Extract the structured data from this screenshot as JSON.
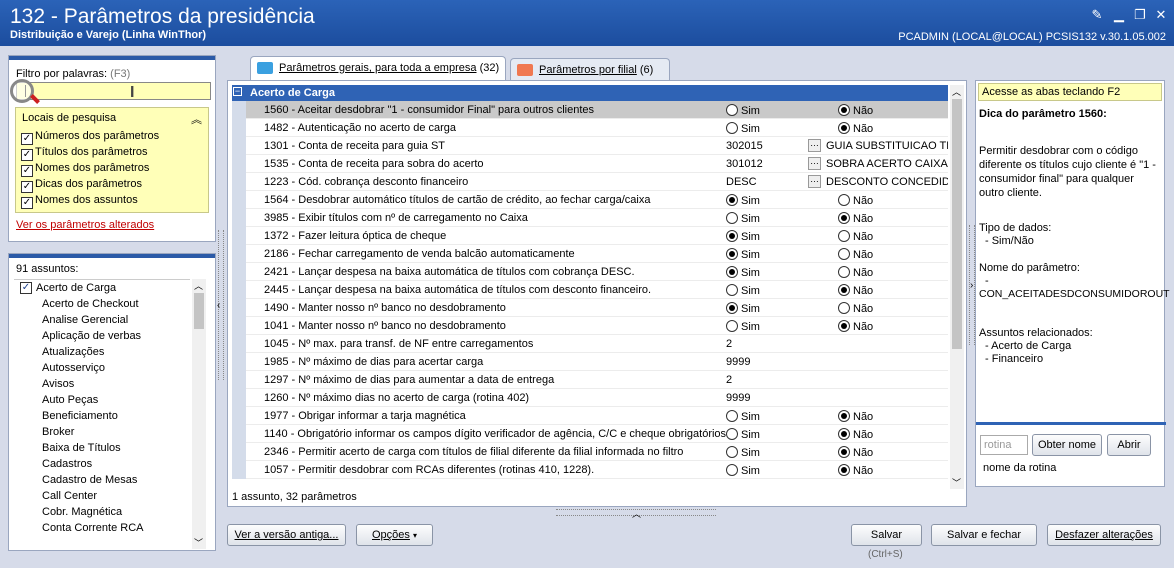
{
  "window": {
    "title": "132 - Parâmetros da presidência",
    "subtitle": "Distribuição e Varejo (Linha WinThor)",
    "user_info": "PCADMIN (LOCAL@LOCAL)   PCSIS132  v.30.1.05.002",
    "colors": {
      "titlebar": "#2b63b8",
      "section": "#2f63b5",
      "highlight": "#ffffb8",
      "link": "#c00000"
    }
  },
  "filter": {
    "label": "Filtro por palavras:",
    "hint": "(F3)",
    "value": "",
    "locais_title": "Locais de pesquisa",
    "locais": [
      "Números dos parâmetros",
      "Títulos dos parâmetros",
      "Nomes dos parâmetros",
      "Dicas dos parâmetros",
      "Nomes dos assuntos"
    ],
    "changed_link": "Ver os parâmetros alterados"
  },
  "subjects": {
    "count_label": "91 assuntos:",
    "items": [
      "Acerto de Carga",
      "Acerto de Checkout",
      "Analise Gerencial",
      "Aplicação de verbas",
      "Atualizações",
      "Autosserviço",
      "Avisos",
      "Auto Peças",
      "Beneficiamento",
      "Broker",
      "Baixa de Títulos",
      "Cadastros",
      "Cadastro de Mesas",
      "Call Center",
      "Cobr. Magnética",
      "Conta Corrente RCA"
    ],
    "selected": "Acerto de Carga"
  },
  "tabs": [
    {
      "label": "Parâmetros gerais, para toda a empresa",
      "count": "(32)"
    },
    {
      "label": "Parâmetros por filial",
      "count": "(6)"
    }
  ],
  "grid": {
    "section": "Acerto de Carga",
    "sim": "Sim",
    "nao": "Não",
    "rows": [
      {
        "label": "1560 - Aceitar desdobrar \"1 - consumidor Final\" para outros clientes",
        "type": "radio",
        "value": "nao"
      },
      {
        "label": "1482 - Autenticação no acerto de carga",
        "type": "radio",
        "value": "nao"
      },
      {
        "label": "1301 - Conta de receita para guia ST",
        "type": "lookup",
        "value": "302015",
        "desc": "GUIA SUBSTITUICAO TRI"
      },
      {
        "label": "1535 - Conta de receita para sobra do acerto",
        "type": "lookup",
        "value": "301012",
        "desc": "SOBRA ACERTO CAIXA"
      },
      {
        "label": "1223 - Cód. cobrança desconto financeiro",
        "type": "lookup",
        "value": "DESC",
        "desc": "DESCONTO CONCEDIDO"
      },
      {
        "label": "1564 - Desdobrar automático títulos de cartão de crédito, ao fechar carga/caixa",
        "type": "radio",
        "value": "sim"
      },
      {
        "label": "3985 - Exibir títulos com nº de carregamento no Caixa",
        "type": "radio",
        "value": "nao"
      },
      {
        "label": "1372 - Fazer leitura óptica de cheque",
        "type": "radio",
        "value": "sim"
      },
      {
        "label": "2186 - Fechar carregamento de venda balcão automaticamente",
        "type": "radio",
        "value": "sim"
      },
      {
        "label": "2421 - Lançar despesa na baixa automática de títulos com cobrança DESC.",
        "type": "radio",
        "value": "sim"
      },
      {
        "label": "2445 - Lançar despesa na baixa automática de títulos com desconto financeiro.",
        "type": "radio",
        "value": "nao"
      },
      {
        "label": "1490 - Manter nosso nº banco no desdobramento",
        "type": "radio",
        "value": "sim"
      },
      {
        "label": "1041 - Manter nosso nº banco no desdobramento",
        "type": "radio",
        "value": "nao"
      },
      {
        "label": "1045 - Nº max. para transf. de NF entre carregamentos",
        "type": "text",
        "value": "2"
      },
      {
        "label": "1985 - Nº máximo de dias para acertar carga",
        "type": "text",
        "value": "9999"
      },
      {
        "label": "1297 - Nº máximo de dias para aumentar a data de entrega",
        "type": "text",
        "value": "2"
      },
      {
        "label": "1260 - Nº máximo dias no acerto de carga (rotina 402)",
        "type": "text",
        "value": "9999"
      },
      {
        "label": "1977 - Obrigar informar a tarja magnética",
        "type": "radio",
        "value": "nao"
      },
      {
        "label": "1140 - Obrigatório informar os campos dígito verificador de agência, C/C e cheque obrigatórios",
        "type": "radio",
        "value": "nao"
      },
      {
        "label": "2346 - Permitir acerto de carga com títulos de filial diferente da filial informada no filtro",
        "type": "radio",
        "value": "nao"
      },
      {
        "label": "1057 - Permitir desdobrar com RCAs diferentes (rotinas 410, 1228).",
        "type": "radio",
        "value": "nao"
      }
    ],
    "footer": "1 assunto, 32 parâmetros"
  },
  "tip": {
    "access_hint": "Acesse as abas teclando F2",
    "title": "Dica do parâmetro 1560:",
    "body": "Permitir desdobrar com o código diferente os títulos cujo cliente é \"1 - consumidor final\" para qualquer outro cliente.",
    "type_label": "Tipo de dados:",
    "type_value": "- Sim/Não",
    "name_label": "Nome do parâmetro:",
    "name_dash": "-",
    "name_value": "CON_ACEITADESDCONSUMIDOROUT",
    "subjects_label": "Assuntos relacionados:",
    "subjects": [
      "- Acerto de Carga",
      "- Financeiro"
    ]
  },
  "rotina": {
    "placeholder": "rotina",
    "obter": "Obter nome",
    "abrir": "Abrir",
    "name_label": "nome da rotina"
  },
  "buttons": {
    "old_version": "Ver a versão antiga...",
    "options": "Opções",
    "save": "Salvar",
    "save_shortcut": "(Ctrl+S)",
    "save_close": "Salvar e fechar",
    "undo": "Desfazer alterações"
  }
}
